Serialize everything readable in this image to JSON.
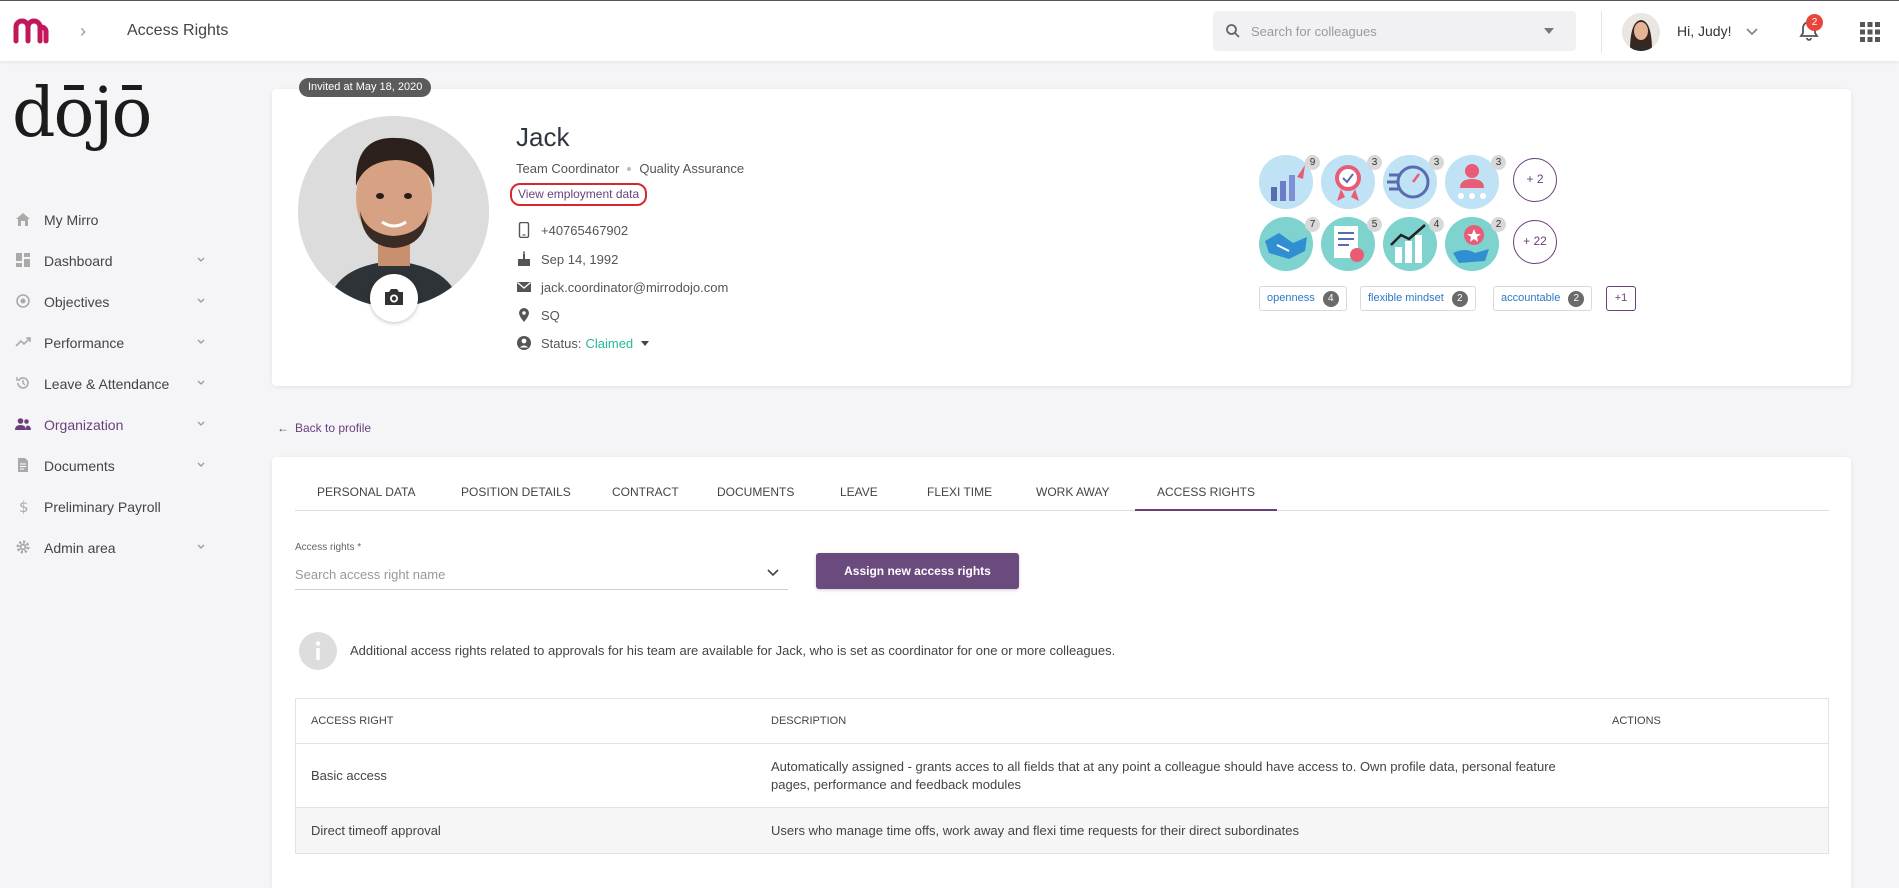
{
  "topbar": {
    "breadcrumb_title": "Access Rights",
    "search_placeholder": "Search for colleagues",
    "greeting": "Hi, Judy!",
    "notification_count": "2"
  },
  "sidebar": {
    "brand": "dōjō",
    "items": [
      {
        "label": "My Mirro",
        "icon": "home-icon",
        "has_chevron": false
      },
      {
        "label": "Dashboard",
        "icon": "dashboard-icon",
        "has_chevron": true
      },
      {
        "label": "Objectives",
        "icon": "target-icon",
        "has_chevron": true
      },
      {
        "label": "Performance",
        "icon": "trend-icon",
        "has_chevron": true
      },
      {
        "label": "Leave & Attendance",
        "icon": "history-icon",
        "has_chevron": true
      },
      {
        "label": "Organization",
        "icon": "people-icon",
        "has_chevron": true,
        "active": true
      },
      {
        "label": "Documents",
        "icon": "document-icon",
        "has_chevron": true
      },
      {
        "label": "Preliminary Payroll",
        "icon": "dollar-icon",
        "has_chevron": false
      },
      {
        "label": "Admin area",
        "icon": "gear-icon",
        "has_chevron": true
      }
    ]
  },
  "profile": {
    "invited": "Invited at May 18, 2020",
    "name": "Jack",
    "role": "Team Coordinator",
    "department": "Quality Assurance",
    "view_employment": "View employment data",
    "phone": "+40765467902",
    "birthday": "Sep 14, 1992",
    "email": "jack.coordinator@mirrodojo.com",
    "location": "SQ",
    "status_label": "Status:",
    "status_value": "Claimed",
    "badges_row1": [
      {
        "icon": "rocket-chart-badge-icon",
        "count": "9"
      },
      {
        "icon": "award-check-badge-icon",
        "count": "3"
      },
      {
        "icon": "speed-clock-badge-icon",
        "count": "3"
      },
      {
        "icon": "person-stars-badge-icon",
        "count": "3"
      }
    ],
    "badges_row1_more": "+ 2",
    "badges_row2": [
      {
        "icon": "handshake-badge-icon",
        "count": "7"
      },
      {
        "icon": "certificate-badge-icon",
        "count": "5"
      },
      {
        "icon": "growth-chart-badge-icon",
        "count": "4"
      },
      {
        "icon": "hand-star-badge-icon",
        "count": "2"
      }
    ],
    "badges_row2_more": "+ 22",
    "tags": [
      {
        "label": "openness",
        "count": "4"
      },
      {
        "label": "flexible mindset",
        "count": "2"
      },
      {
        "label": "accountable",
        "count": "2"
      }
    ],
    "tags_more": "+1"
  },
  "back_link": "Back to profile",
  "tabs": [
    "PERSONAL DATA",
    "POSITION DETAILS",
    "CONTRACT",
    "DOCUMENTS",
    "LEAVE",
    "FLEXI TIME",
    "WORK AWAY",
    "ACCESS RIGHTS"
  ],
  "active_tab": "ACCESS RIGHTS",
  "access_form": {
    "label": "Access rights *",
    "placeholder": "Search access right name",
    "assign_button": "Assign new access rights"
  },
  "info_note": "Additional access rights related to approvals for his team are available for Jack, who is set as coordinator for one or more colleagues.",
  "table": {
    "headers": [
      "ACCESS RIGHT",
      "DESCRIPTION",
      "ACTIONS"
    ],
    "rows": [
      {
        "right": "Basic access",
        "description": "Automatically assigned - grants acces to all fields that at any point a colleague should have access to. Own profile data, personal feature pages, performance and feedback modules"
      },
      {
        "right": "Direct timeoff approval",
        "description": "Users who manage time offs, work away and flexi time requests for their direct subordinates"
      }
    ]
  },
  "colors": {
    "accent": "#6b3f7c",
    "brand_logo": "#c2185b",
    "status_claimed": "#25b89a",
    "highlight_outline": "#d6292f",
    "notification_badge": "#e8453c"
  }
}
